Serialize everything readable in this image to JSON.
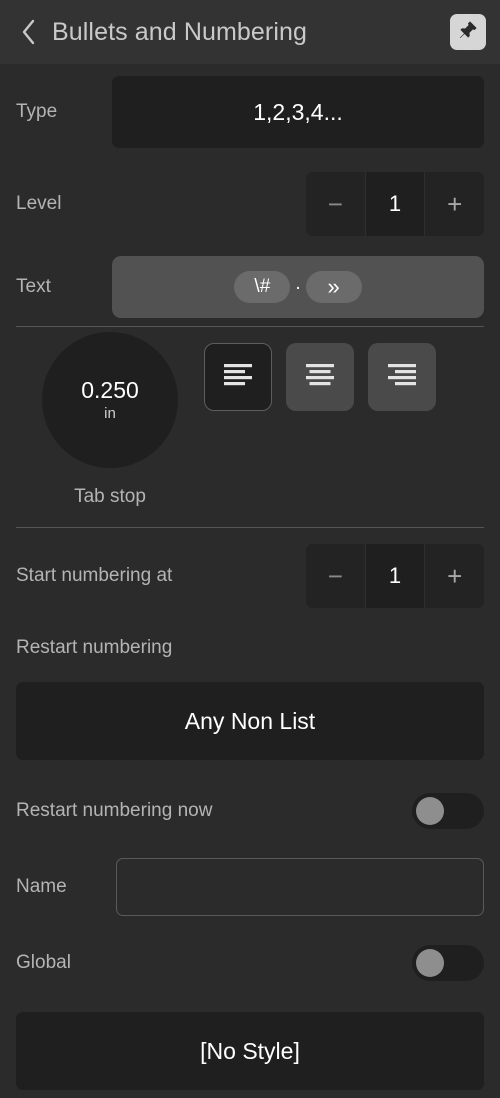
{
  "header": {
    "back_icon": "chevron-left-icon",
    "title": "Bullets and Numbering",
    "pin_icon": "pushpin-icon"
  },
  "type_row": {
    "label": "Type",
    "value": "1,2,3,4..."
  },
  "level_row": {
    "label": "Level",
    "value": "1",
    "minus": "−",
    "plus": "+"
  },
  "text_row": {
    "label": "Text",
    "token_number": "\\#",
    "separator": ".",
    "token_tab": "»"
  },
  "tab_stop": {
    "value": "0.250",
    "unit": "in",
    "caption": "Tab stop"
  },
  "alignment": {
    "left_icon": "align-left-icon",
    "center_icon": "align-center-icon",
    "right_icon": "align-right-icon",
    "selected": "left"
  },
  "start_numbering": {
    "label": "Start numbering at",
    "value": "1",
    "minus": "−",
    "plus": "+"
  },
  "restart_numbering": {
    "label": "Restart numbering",
    "value": "Any Non List"
  },
  "restart_now": {
    "label": "Restart numbering now",
    "state": "off"
  },
  "name_row": {
    "label": "Name",
    "value": "",
    "placeholder": ""
  },
  "global_row": {
    "label": "Global",
    "state": "off"
  },
  "style_button": {
    "label": "[No Style]"
  },
  "colors": {
    "background": "#2b2b2b",
    "header_background": "#333333",
    "control_background": "#1f1f1f",
    "field_background": "#525252",
    "token_background": "#6b6b6b",
    "align_background": "#4a4a4a",
    "label_text": "#b4b4b4",
    "value_text": "#ffffff",
    "divider": "#565656",
    "toggle_knob": "#8e8e8e",
    "pin_chip": "#d6d6d6"
  }
}
